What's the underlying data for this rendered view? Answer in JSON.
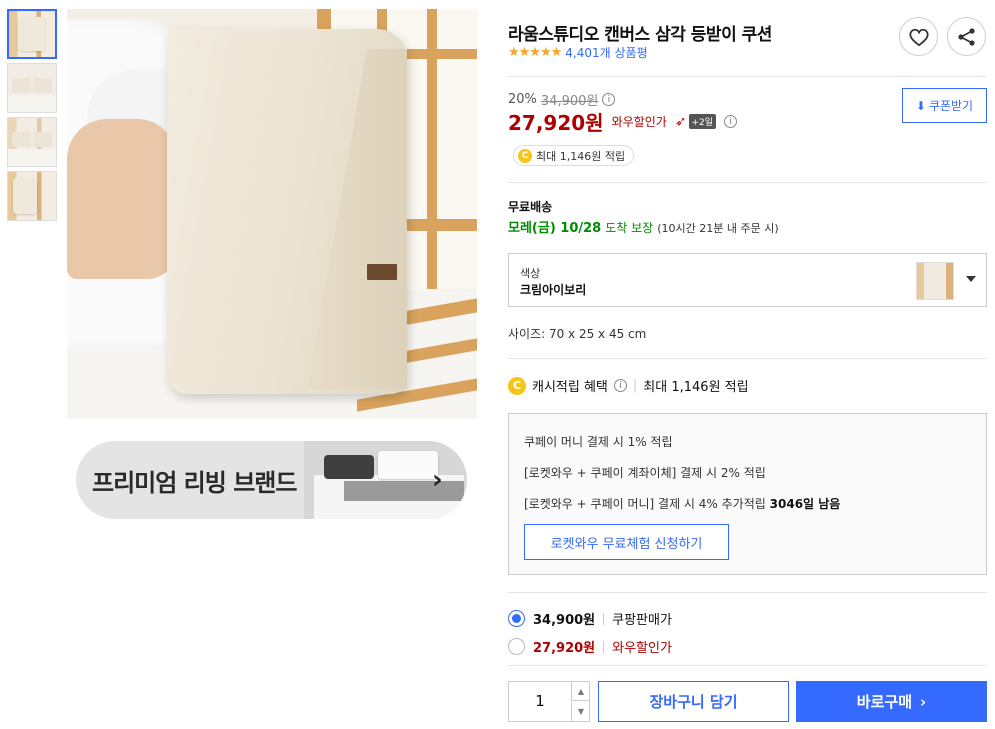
{
  "product": {
    "title": "라움스튜디오 캔버스 삼각 등받이 쿠션",
    "stars": "★★★★★",
    "review_count": "4,401개 상품평"
  },
  "price": {
    "discount_rate": "20%",
    "original": "34,900원",
    "sale": "27,920원",
    "sale_label": "와우할인가",
    "badge_plus": "+2일",
    "coupon_label": "쿠폰받기",
    "cash_pill": "최대 1,146원 적립",
    "coin_symbol": "C"
  },
  "shipping": {
    "title": "무료배송",
    "date": "모레(금) 10/28",
    "guarantee": "도착 보장",
    "note": "(10시간 21분 내 주문 시)"
  },
  "option": {
    "key": "색상",
    "value": "크림아이보리"
  },
  "size_text": "사이즈: 70 x 25 x 45 cm",
  "cash_benefit": {
    "label": "캐시적립 혜택",
    "max": "최대 1,146원 적립",
    "lines": [
      "쿠페이 머니 결제 시 1% 적립",
      "[로켓와우 + 쿠페이 계좌이체] 결제 시 2% 적립",
      "[로켓와우 + 쿠페이 머니] 결제 시 4% 추가적립",
      "3046일 남음"
    ],
    "trial_button": "로켓와우 무료체험 신청하기"
  },
  "price_options": [
    {
      "price": "34,900원",
      "label": "쿠팡판매가",
      "selected": true
    },
    {
      "price": "27,920원",
      "label": "와우할인가",
      "selected": false
    }
  ],
  "purchase": {
    "quantity": "1",
    "cart_button": "장바구니 담기",
    "buy_button": "바로구매"
  },
  "banner": {
    "text": "프리미엄 리빙 브랜드"
  },
  "colors": {
    "accent": "#346aff",
    "price_red": "#ae0000",
    "delivery_green": "#008c00",
    "star": "#f5a623"
  }
}
